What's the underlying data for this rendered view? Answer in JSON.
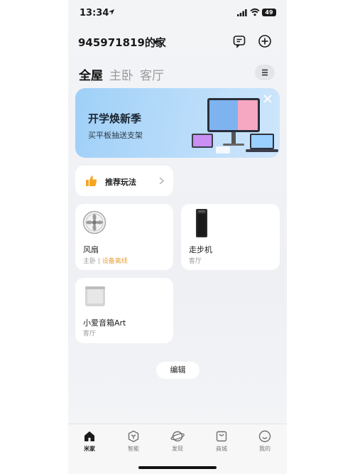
{
  "status_bar": {
    "time": "13:34",
    "battery": "49"
  },
  "header": {
    "home_name": "945971819的家"
  },
  "tabs": [
    {
      "label": "全屋",
      "active": true
    },
    {
      "label": "主卧",
      "active": false
    },
    {
      "label": "客厅",
      "active": false
    }
  ],
  "banner": {
    "title": "开学焕新季",
    "subtitle": "买平板抽送支架"
  },
  "recommend": {
    "label": "推荐玩法"
  },
  "devices": [
    {
      "name": "风扇",
      "room": "主卧",
      "status": "设备离线",
      "icon": "fan-icon"
    },
    {
      "name": "走步机",
      "room": "客厅",
      "status": "",
      "icon": "treadmill-icon"
    },
    {
      "name": "小爱音箱Art",
      "room": "客厅",
      "status": "",
      "icon": "speaker-icon"
    }
  ],
  "edit_label": "编辑",
  "nav": [
    {
      "label": "米家",
      "icon": "home-icon",
      "active": true
    },
    {
      "label": "智能",
      "icon": "smart-icon",
      "active": false
    },
    {
      "label": "发现",
      "icon": "planet-icon",
      "active": false
    },
    {
      "label": "商城",
      "icon": "shop-icon",
      "active": false
    },
    {
      "label": "我的",
      "icon": "profile-icon",
      "active": false
    }
  ],
  "colors": {
    "accent_offline": "#e8a23a",
    "banner_bg": "#b9dcfa",
    "thumb_icon": "#f5a623"
  }
}
